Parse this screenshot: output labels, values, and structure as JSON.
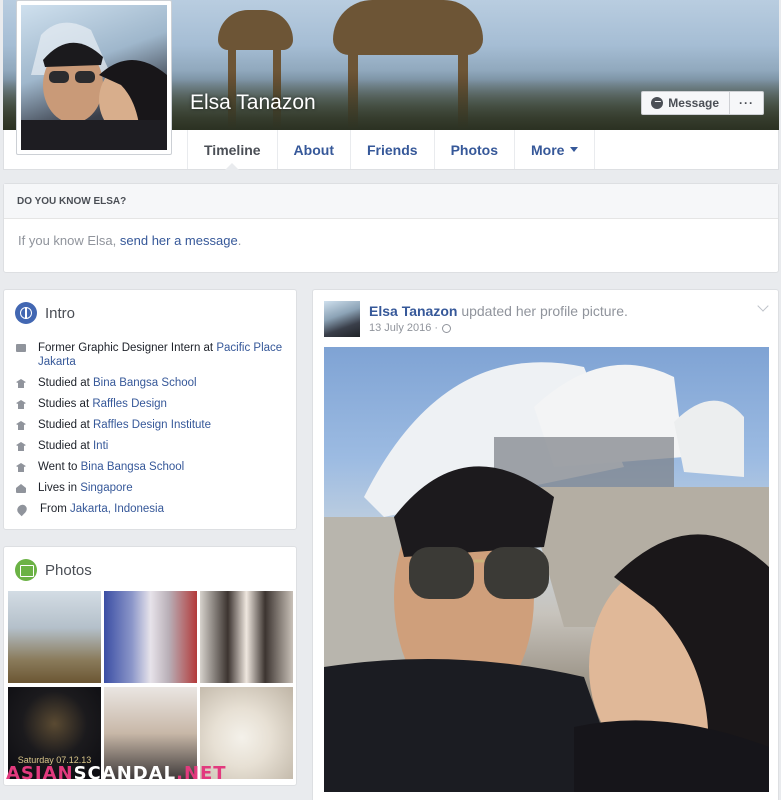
{
  "profile": {
    "name": "Elsa Tanazon",
    "message_button": "Message",
    "more_button": "···"
  },
  "nav": {
    "tabs": [
      {
        "label": "Timeline",
        "active": true
      },
      {
        "label": "About"
      },
      {
        "label": "Friends"
      },
      {
        "label": "Photos"
      },
      {
        "label": "More"
      }
    ]
  },
  "know": {
    "heading": "DO YOU KNOW ELSA?",
    "text_before": "If you know Elsa, ",
    "link": "send her a message",
    "text_after": "."
  },
  "intro": {
    "title": "Intro",
    "items": [
      {
        "icon": "briefcase-icon",
        "prefix": "Former Graphic Designer Intern at ",
        "link": "Pacific Place Jakarta"
      },
      {
        "icon": "graduation-cap-icon",
        "prefix": "Studied at ",
        "link": "Bina Bangsa School"
      },
      {
        "icon": "graduation-cap-icon",
        "prefix": "Studies at ",
        "link": "Raffles Design"
      },
      {
        "icon": "graduation-cap-icon",
        "prefix": "Studied at ",
        "link": "Raffles Design Institute"
      },
      {
        "icon": "graduation-cap-icon",
        "prefix": "Studied at ",
        "link": "Inti"
      },
      {
        "icon": "graduation-cap-icon",
        "prefix": "Went to ",
        "link": "Bina Bangsa School"
      },
      {
        "icon": "house-icon",
        "prefix": "Lives in ",
        "link": "Singapore"
      },
      {
        "icon": "location-pin-icon",
        "prefix": "From ",
        "link": "Jakarta, Indonesia"
      }
    ]
  },
  "photos": {
    "title": "Photos",
    "event_caption": "Saturday 07.12.13"
  },
  "post": {
    "author": "Elsa Tanazon",
    "action": " updated her profile picture.",
    "date": "13 July 2016 ·"
  },
  "watermark": {
    "part1": "ASIAN",
    "part2": "SCANDAL",
    "part3": ".NET"
  },
  "colors": {
    "link": "#365899",
    "page_bg": "#e9ebee",
    "intro_icon": "#4267b2",
    "photos_icon": "#6bb245"
  }
}
